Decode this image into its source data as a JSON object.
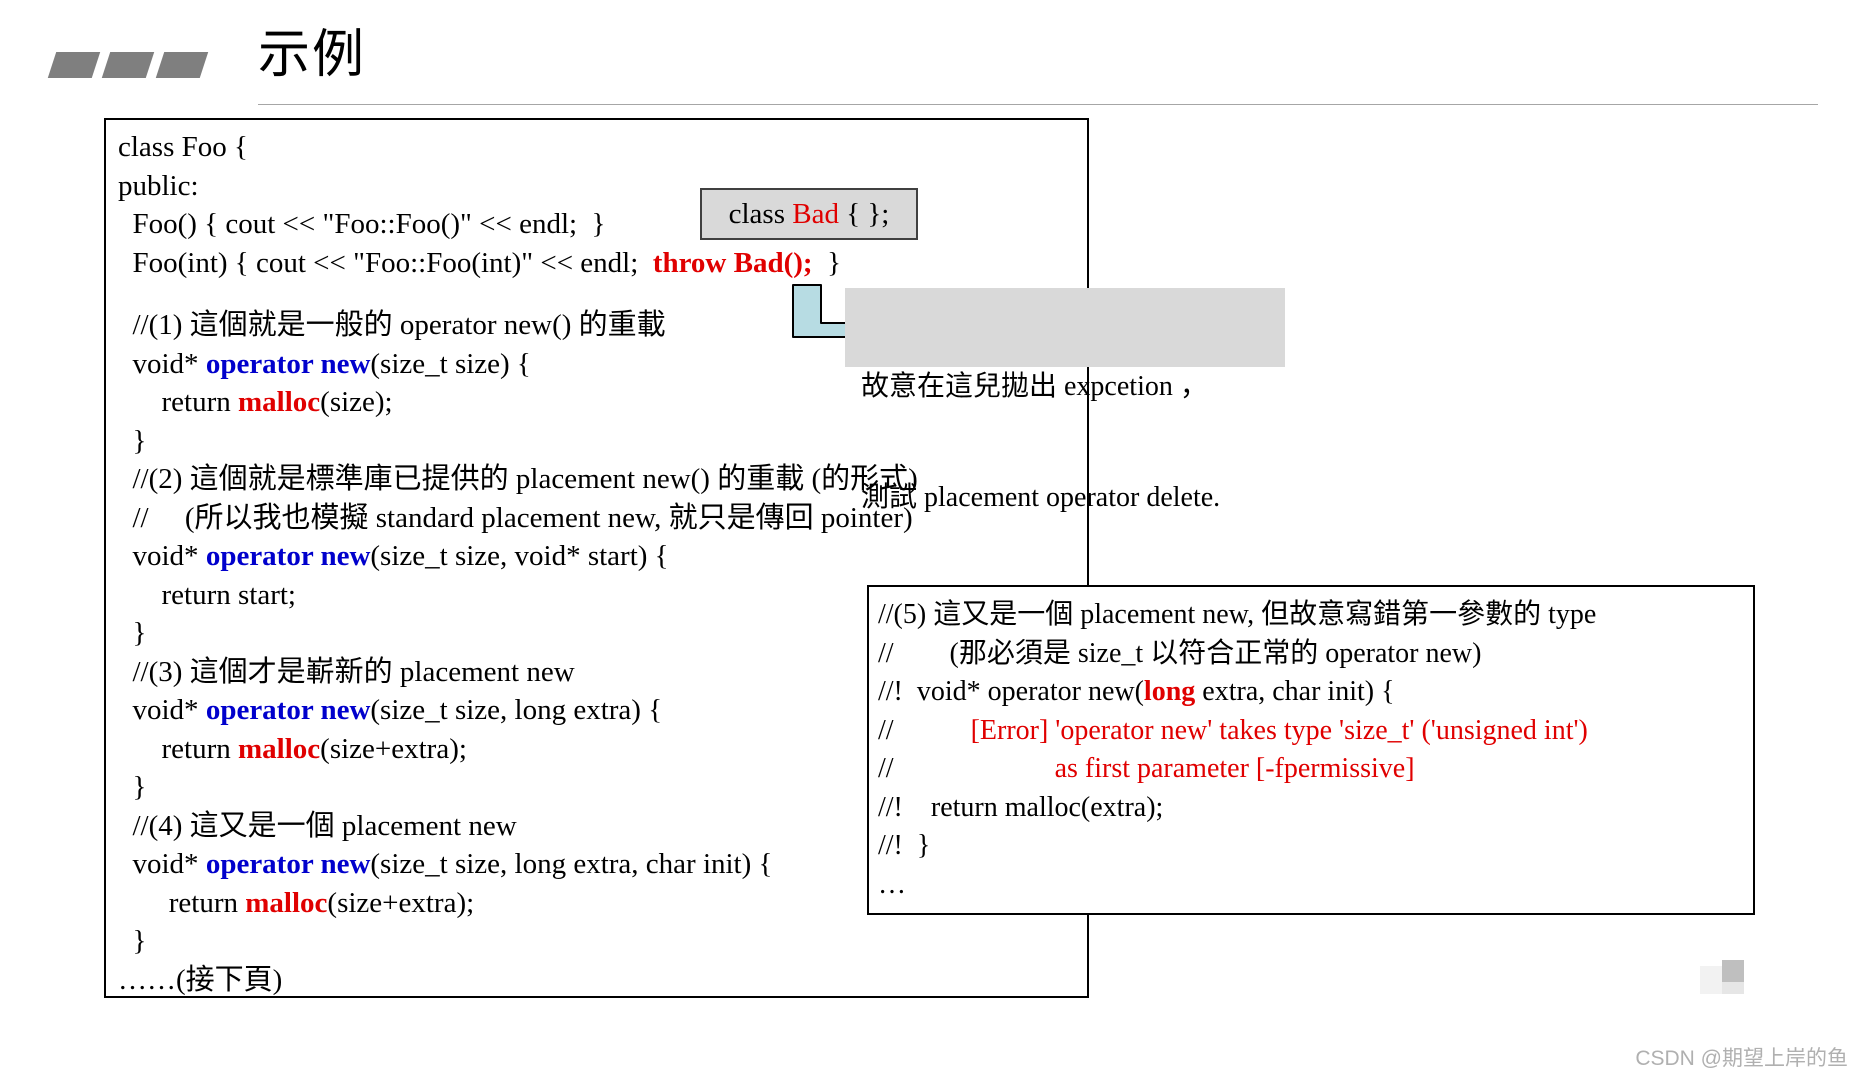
{
  "slide": {
    "title": "示例",
    "bullet_block_count": 3,
    "bullet_block_color": "#7f7f7f"
  },
  "code_block": {
    "lines": [
      {
        "id": "l1",
        "type": "text",
        "text": "class Foo {"
      },
      {
        "id": "l2",
        "type": "text",
        "text": "public:"
      },
      {
        "id": "l3",
        "type": "text",
        "text": "  Foo() { cout << \"Foo::Foo()\" << endl;  }"
      },
      {
        "id": "l4",
        "type": "rich",
        "pre": "  Foo(int) { cout << \"Foo::Foo(int)\" << endl;  ",
        "accent": "throw Bad();",
        "accent_color": "#e00000",
        "post": "  }"
      },
      {
        "id": "l5",
        "type": "spacer",
        "text": ""
      },
      {
        "id": "l6",
        "type": "text",
        "text": "  //(1) 這個就是一般的 operator new() 的重載"
      },
      {
        "id": "l7",
        "type": "rich",
        "pre": "  void* ",
        "accent": "operator new",
        "accent_color": "#0000cc",
        "post": "(size_t size) {"
      },
      {
        "id": "l8",
        "type": "rich",
        "pre": "      return ",
        "accent": "malloc",
        "accent_color": "#e00000",
        "post": "(size);"
      },
      {
        "id": "l9",
        "type": "text",
        "text": "  }"
      },
      {
        "id": "l10",
        "type": "text",
        "text": "  //(2) 這個就是標準庫已提供的 placement new() 的重載 (的形式)"
      },
      {
        "id": "l11",
        "type": "text",
        "text": "  //     (所以我也模擬 standard placement new, 就只是傳回 pointer)"
      },
      {
        "id": "l12",
        "type": "rich",
        "pre": "  void* ",
        "accent": "operator new",
        "accent_color": "#0000cc",
        "post": "(size_t size, void* start) {"
      },
      {
        "id": "l13",
        "type": "text",
        "text": "      return start;"
      },
      {
        "id": "l14",
        "type": "text",
        "text": "  }"
      },
      {
        "id": "l15",
        "type": "text",
        "text": "  //(3) 這個才是嶄新的 placement new"
      },
      {
        "id": "l16",
        "type": "rich",
        "pre": "  void* ",
        "accent": "operator new",
        "accent_color": "#0000cc",
        "post": "(size_t size, long extra) {"
      },
      {
        "id": "l17",
        "type": "rich",
        "pre": "      return ",
        "accent": "malloc",
        "accent_color": "#e00000",
        "post": "(size+extra);"
      },
      {
        "id": "l18",
        "type": "text",
        "text": "  }"
      },
      {
        "id": "l19",
        "type": "text",
        "text": "  //(4) 這又是一個 placement new"
      },
      {
        "id": "l20",
        "type": "rich",
        "pre": "  void* ",
        "accent": "operator new",
        "accent_color": "#0000cc",
        "post": "(size_t size, long extra, char init) {"
      },
      {
        "id": "l21",
        "type": "rich",
        "pre": "       return ",
        "accent": "malloc",
        "accent_color": "#e00000",
        "post": "(size+extra);"
      },
      {
        "id": "l22",
        "type": "text",
        "text": "  }"
      },
      {
        "id": "l23",
        "type": "text",
        "text": "……(接下頁)"
      }
    ]
  },
  "class_bad_callout": {
    "pre": "class ",
    "accent": "Bad",
    "accent_color": "#e00000",
    "post": " { };",
    "bg": "#d9d9d9",
    "border": "#404040"
  },
  "note_box": {
    "line1": "故意在這兒拋出 expcetion ，",
    "line2": "測試 placement operator delete.",
    "bg": "#d9d9d9"
  },
  "arrow": {
    "name": "curved-arrow",
    "fill": "#b7dce3",
    "stroke": "#000000"
  },
  "note5_box": {
    "lines": [
      {
        "id": "n1",
        "type": "text",
        "text": "//(5) 這又是一個 placement new, 但故意寫錯第一參數的 type"
      },
      {
        "id": "n2",
        "type": "text",
        "text": "//        (那必須是 size_t 以符合正常的 operator new)"
      },
      {
        "id": "n3",
        "type": "rich",
        "pre": "//!  void* operator new(",
        "accent": "long",
        "accent_color": "#e00000",
        "accent_bold": true,
        "post": " extra, char init) {"
      },
      {
        "id": "n4",
        "type": "colored",
        "text": "//           [Error] 'operator new' takes type 'size_t' ('unsigned int')",
        "color": "#e00000",
        "indent_plain": "//"
      },
      {
        "id": "n5",
        "type": "colored",
        "text": "//                       as first parameter [-fpermissive]",
        "color": "#e00000",
        "indent_plain": "//"
      },
      {
        "id": "n6",
        "type": "text",
        "text": "//!    return malloc(extra);"
      },
      {
        "id": "n7",
        "type": "text",
        "text": "//!  }"
      },
      {
        "id": "n8",
        "type": "text",
        "text": "…"
      }
    ]
  },
  "footer": {
    "watermark": "CSDN @期望上岸的鱼"
  }
}
